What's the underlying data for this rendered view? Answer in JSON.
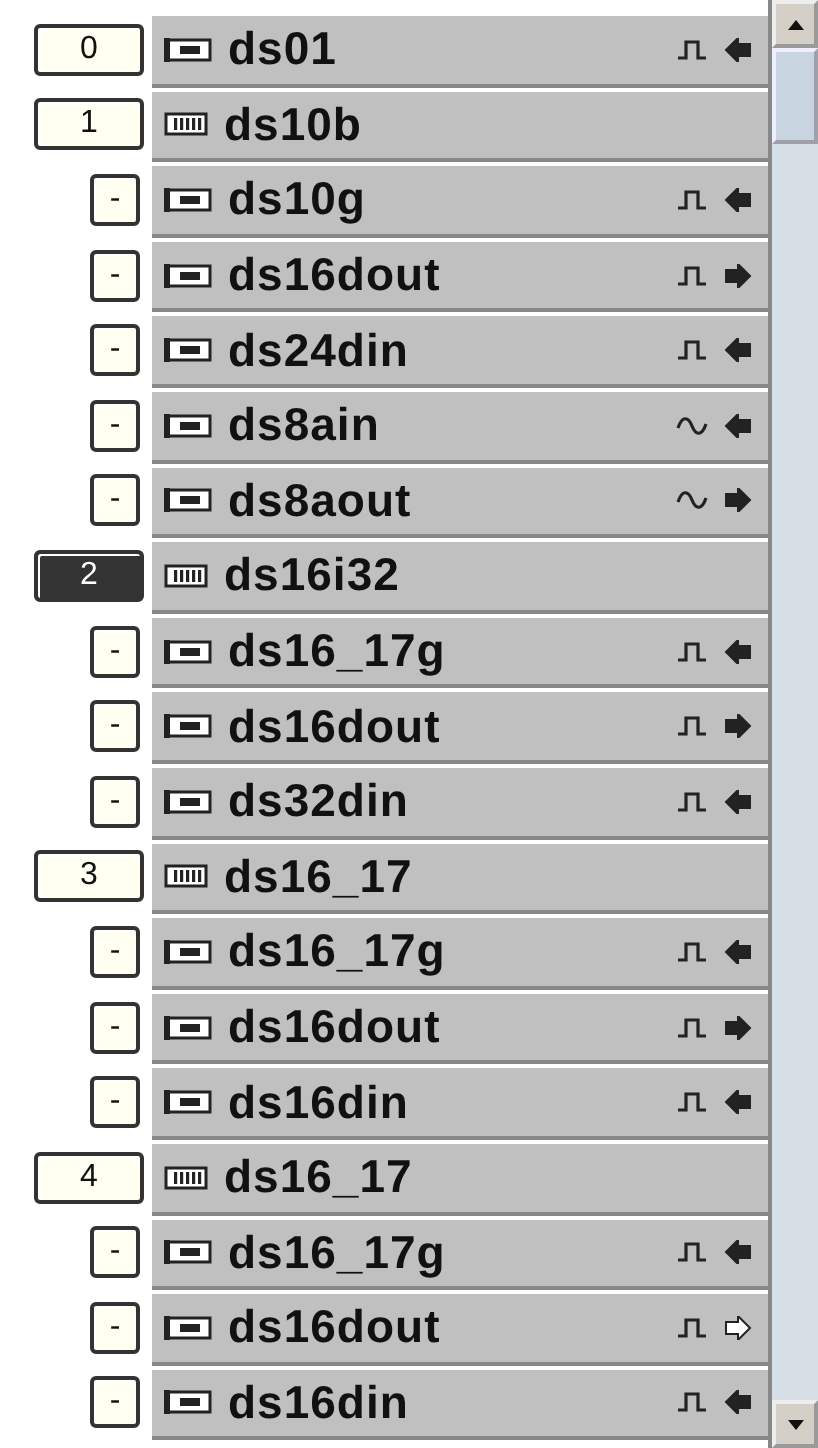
{
  "rows": [
    {
      "kind": "module",
      "badge": "0",
      "selected": false,
      "name": "ds01",
      "icon": {
        "kind": "card"
      },
      "signal": {
        "kind": "pulse",
        "output": false,
        "active": true
      }
    },
    {
      "kind": "module",
      "badge": "1",
      "selected": false,
      "name": "ds10b",
      "icon": {
        "kind": "rack"
      }
    },
    {
      "kind": "channel",
      "badge": "-",
      "selected": false,
      "name": "ds10g",
      "icon": {
        "kind": "card"
      },
      "signal": {
        "kind": "pulse",
        "output": false,
        "active": true
      }
    },
    {
      "kind": "channel",
      "badge": "-",
      "selected": false,
      "name": "ds16dout",
      "icon": {
        "kind": "card"
      },
      "signal": {
        "kind": "pulse",
        "output": true,
        "active": true
      }
    },
    {
      "kind": "channel",
      "badge": "-",
      "selected": false,
      "name": "ds24din",
      "icon": {
        "kind": "card"
      },
      "signal": {
        "kind": "pulse",
        "output": false,
        "active": true
      }
    },
    {
      "kind": "channel",
      "badge": "-",
      "selected": false,
      "name": "ds8ain",
      "icon": {
        "kind": "card"
      },
      "signal": {
        "kind": "sine",
        "output": false,
        "active": true
      }
    },
    {
      "kind": "channel",
      "badge": "-",
      "selected": false,
      "name": "ds8aout",
      "icon": {
        "kind": "card"
      },
      "signal": {
        "kind": "sine",
        "output": true,
        "active": true
      }
    },
    {
      "kind": "module",
      "badge": "2",
      "selected": true,
      "name": "ds16i32",
      "icon": {
        "kind": "rack"
      }
    },
    {
      "kind": "channel",
      "badge": "-",
      "selected": false,
      "name": "ds16_17g",
      "icon": {
        "kind": "card"
      },
      "signal": {
        "kind": "pulse",
        "output": false,
        "active": true
      }
    },
    {
      "kind": "channel",
      "badge": "-",
      "selected": false,
      "name": "ds16dout",
      "icon": {
        "kind": "card"
      },
      "signal": {
        "kind": "pulse",
        "output": true,
        "active": true
      }
    },
    {
      "kind": "channel",
      "badge": "-",
      "selected": false,
      "name": "ds32din",
      "icon": {
        "kind": "card"
      },
      "signal": {
        "kind": "pulse",
        "output": false,
        "active": true
      }
    },
    {
      "kind": "module",
      "badge": "3",
      "selected": false,
      "name": "ds16_17",
      "icon": {
        "kind": "rack"
      }
    },
    {
      "kind": "channel",
      "badge": "-",
      "selected": false,
      "name": "ds16_17g",
      "icon": {
        "kind": "card"
      },
      "signal": {
        "kind": "pulse",
        "output": false,
        "active": true
      }
    },
    {
      "kind": "channel",
      "badge": "-",
      "selected": false,
      "name": "ds16dout",
      "icon": {
        "kind": "card"
      },
      "signal": {
        "kind": "pulse",
        "output": true,
        "active": true
      }
    },
    {
      "kind": "channel",
      "badge": "-",
      "selected": false,
      "name": "ds16din",
      "icon": {
        "kind": "card"
      },
      "signal": {
        "kind": "pulse",
        "output": false,
        "active": true
      }
    },
    {
      "kind": "module",
      "badge": "4",
      "selected": false,
      "name": "ds16_17",
      "icon": {
        "kind": "rack"
      }
    },
    {
      "kind": "channel",
      "badge": "-",
      "selected": false,
      "name": "ds16_17g",
      "icon": {
        "kind": "card"
      },
      "signal": {
        "kind": "pulse",
        "output": false,
        "active": true
      }
    },
    {
      "kind": "channel",
      "badge": "-",
      "selected": false,
      "name": "ds16dout",
      "icon": {
        "kind": "card"
      },
      "signal": {
        "kind": "pulse",
        "output": true,
        "active": false
      }
    },
    {
      "kind": "channel",
      "badge": "-",
      "selected": false,
      "name": "ds16din",
      "icon": {
        "kind": "card"
      },
      "signal": {
        "kind": "pulse",
        "output": false,
        "active": true
      }
    }
  ]
}
